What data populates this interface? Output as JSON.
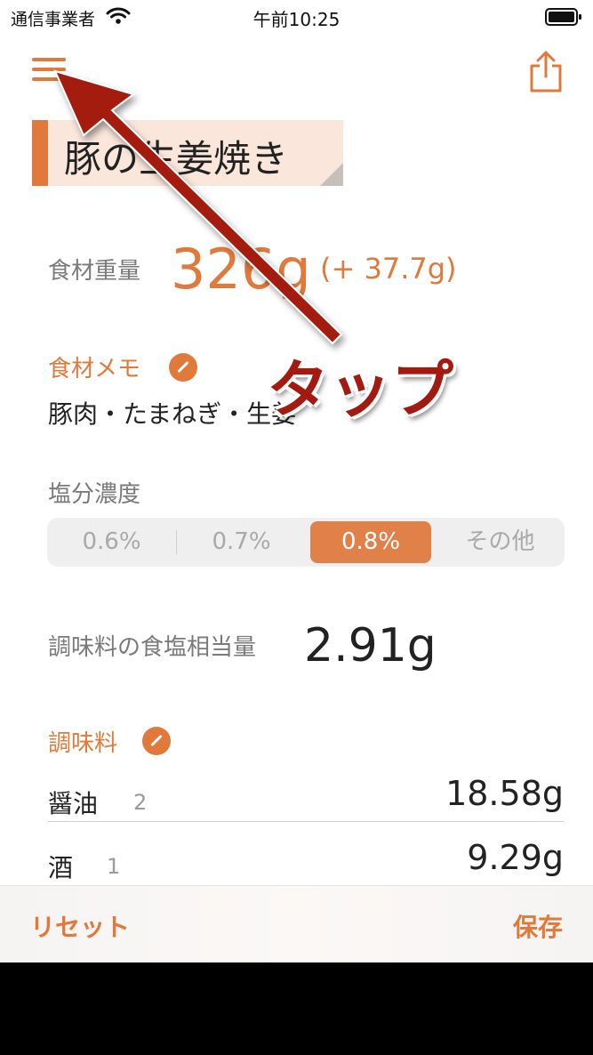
{
  "status_bar": {
    "carrier": "通信事業者",
    "time": "午前10:25"
  },
  "recipe": {
    "title": "豚の生姜焼き"
  },
  "weight": {
    "label": "食材重量",
    "value": "326g",
    "diff": "(+ 37.7g)"
  },
  "memo": {
    "label": "食材メモ",
    "text": "豚肉・たまねぎ・生姜"
  },
  "salt": {
    "label": "塩分濃度",
    "options": [
      "0.6%",
      "0.7%",
      "0.8%",
      "その他"
    ],
    "selected": "0.8%"
  },
  "seasoning_salt": {
    "label": "調味料の食塩相当量",
    "value": "2.91g"
  },
  "seasonings": {
    "label": "調味料",
    "items": [
      {
        "name": "醤油",
        "qty": "2",
        "amount": "18.58g"
      },
      {
        "name": "酒",
        "qty": "1",
        "amount": "9.29g"
      }
    ]
  },
  "toolbar": {
    "reset_label": "リセット",
    "save_label": "保存"
  },
  "annotation": {
    "text": "タップ",
    "color": "#a31a10"
  },
  "colors": {
    "accent": "#e0793a",
    "title_background": "#fbe6dc"
  }
}
